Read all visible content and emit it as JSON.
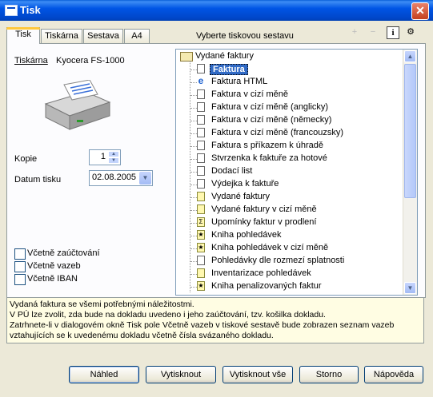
{
  "window": {
    "title": "Tisk"
  },
  "tabs": [
    "Tisk",
    "Tiskárna",
    "Sestava",
    "A4"
  ],
  "report_header": "Vyberte tiskovou sestavu",
  "printer": {
    "link_label": "Tiskárna",
    "name": "Kyocera FS-1000"
  },
  "copies": {
    "label": "Kopie",
    "value": "1"
  },
  "print_date": {
    "label": "Datum tisku",
    "value": "02.08.2005"
  },
  "checkboxes": [
    "Včetně zaúčtování",
    "Včetně vazeb",
    "Včetně IBAN"
  ],
  "tree": {
    "root": "Vydané faktury",
    "items": [
      {
        "label": "Faktura",
        "selected": true,
        "icon": "page"
      },
      {
        "label": "Faktura HTML",
        "icon": "ie"
      },
      {
        "label": "Faktura v cizí měně",
        "icon": "page"
      },
      {
        "label": "Faktura v cizí měně (anglicky)",
        "icon": "page"
      },
      {
        "label": "Faktura v cizí měně (německy)",
        "icon": "page"
      },
      {
        "label": "Faktura v cizí měně (francouzsky)",
        "icon": "page"
      },
      {
        "label": "Faktura s příkazem k úhradě",
        "icon": "page"
      },
      {
        "label": "Stvrzenka k faktuře za hotové",
        "icon": "page"
      },
      {
        "label": "Dodací list",
        "icon": "page"
      },
      {
        "label": "Výdejka k faktuře",
        "icon": "page"
      },
      {
        "label": "Vydané faktury",
        "icon": "yellow"
      },
      {
        "label": "Vydané faktury v cizí měně",
        "icon": "yellow"
      },
      {
        "label": "Upomínky faktur v prodlení",
        "icon": "sigma"
      },
      {
        "label": "Kniha pohledávek",
        "icon": "star"
      },
      {
        "label": "Kniha pohledávek v cizí měně",
        "icon": "star"
      },
      {
        "label": "Pohledávky dle rozmezí splatnosti",
        "icon": "page"
      },
      {
        "label": "Inventarizace pohledávek",
        "icon": "yellow"
      },
      {
        "label": "Kniha penalizovaných faktur",
        "icon": "star"
      }
    ]
  },
  "description": [
    "Vydaná faktura se všemi potřebnými náležitostmi.",
    "V PÚ lze zvolit, zda bude na dokladu uvedeno i jeho zaúčtování, tzv. košilka dokladu.",
    "Zatrhnete-li v dialogovém okně Tisk pole Včetně vazeb v tiskové sestavě bude zobrazen seznam vazeb",
    "vztahujících se k uvedenému dokladu včetně čísla svázaného dokladu."
  ],
  "buttons": [
    "Náhled",
    "Vytisknout",
    "Vytisknout vše",
    "Storno",
    "Nápověda"
  ],
  "icons": {
    "title": "printer-window-icon",
    "close": "close-icon"
  }
}
